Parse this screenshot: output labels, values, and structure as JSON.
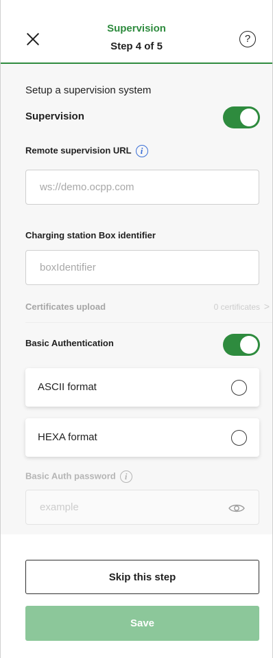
{
  "header": {
    "title": "Supervision",
    "step": "Step 4 of 5",
    "help_glyph": "?"
  },
  "content": {
    "section_title": "Setup a supervision system",
    "supervision": {
      "label": "Supervision",
      "enabled": true
    },
    "remote_url": {
      "label": "Remote supervision URL",
      "placeholder": "ws://demo.ocpp.com",
      "value": ""
    },
    "box_identifier": {
      "label": "Charging station Box identifier",
      "placeholder": "boxIdentifier",
      "value": ""
    },
    "certificates": {
      "label": "Certificates upload",
      "value": "0 certificates",
      "chevron": ">"
    },
    "basic_auth": {
      "label": "Basic Authentication",
      "enabled": true,
      "options": [
        {
          "label": "ASCII format",
          "selected": false
        },
        {
          "label": "HEXA format",
          "selected": false
        }
      ]
    },
    "password": {
      "label": "Basic Auth password",
      "placeholder": "example",
      "value": ""
    },
    "info_glyph": "i"
  },
  "footer": {
    "skip_label": "Skip this step",
    "save_label": "Save"
  },
  "colors": {
    "accent": "#2e8b3e",
    "save_disabled": "#8cc79a",
    "info": "#3b6fd6"
  },
  "icons": [
    "close-icon",
    "help-icon",
    "info-icon",
    "chevron-right-icon",
    "eye-icon"
  ]
}
